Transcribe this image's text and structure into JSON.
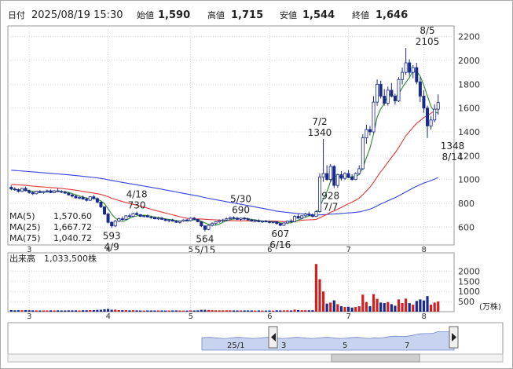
{
  "header": {
    "date_label": "日付",
    "date_value": "2025/08/19 15:30",
    "open_label": "始値",
    "open_value": "1,590",
    "high_label": "高値",
    "high_value": "1,715",
    "low_label": "安値",
    "low_value": "1,544",
    "close_label": "終値",
    "close_value": "1,646",
    "high_color": "#d40000",
    "low_color": "#007a00"
  },
  "legend": {
    "ma5_label": "MA(5)",
    "ma5_value": "1,570.60",
    "ma5_color": "#2a8a2a",
    "ma25_label": "MA(25)",
    "ma25_value": "1,667.72",
    "ma25_color": "#e53333",
    "ma75_label": "MA(75)",
    "ma75_value": "1,040.72",
    "ma75_color": "#3344dd"
  },
  "volume_legend": {
    "label": "出来高",
    "value": "1,033,500株"
  },
  "volume_unit": "(万株)",
  "navigator": {
    "labels": [
      "25/1",
      "3",
      "5",
      "7"
    ]
  },
  "chart_data": {
    "type": "candlestick",
    "months": [
      "3",
      "4",
      "5",
      "6",
      "7",
      "8"
    ],
    "price_ticks": [
      600,
      800,
      1000,
      1200,
      1400,
      1600,
      1800,
      2000,
      2200
    ],
    "price_range": [
      450,
      2290
    ],
    "volume_ticks": [
      500,
      1000,
      1500,
      2000
    ],
    "volume_range": [
      0,
      2400
    ],
    "annotations": [
      {
        "date": "4/9",
        "value": 593,
        "position": "below"
      },
      {
        "date": "4/18",
        "value": 730,
        "position": "above"
      },
      {
        "date": "5/15",
        "value": 564,
        "position": "below"
      },
      {
        "date": "5/30",
        "value": 690,
        "position": "above"
      },
      {
        "date": "6/16",
        "value": 607,
        "position": "below"
      },
      {
        "date": "7/2",
        "value": 1340,
        "position": "above"
      },
      {
        "date": "7/7",
        "value": 928,
        "position": "below"
      },
      {
        "date": "8/5",
        "value": 2105,
        "position": "above"
      },
      {
        "date": "8/14",
        "value": 1348,
        "position": "below"
      }
    ],
    "candles": [
      {
        "o": 935,
        "h": 950,
        "l": 910,
        "c": 920
      },
      {
        "o": 920,
        "h": 935,
        "l": 905,
        "c": 915
      },
      {
        "o": 915,
        "h": 925,
        "l": 890,
        "c": 900
      },
      {
        "o": 900,
        "h": 930,
        "l": 895,
        "c": 925
      },
      {
        "o": 925,
        "h": 940,
        "l": 900,
        "c": 905
      },
      {
        "o": 905,
        "h": 915,
        "l": 880,
        "c": 890
      },
      {
        "o": 890,
        "h": 900,
        "l": 870,
        "c": 880
      },
      {
        "o": 880,
        "h": 905,
        "l": 875,
        "c": 900
      },
      {
        "o": 900,
        "h": 910,
        "l": 885,
        "c": 890
      },
      {
        "o": 890,
        "h": 905,
        "l": 880,
        "c": 900
      },
      {
        "o": 900,
        "h": 915,
        "l": 890,
        "c": 905
      },
      {
        "o": 905,
        "h": 915,
        "l": 885,
        "c": 890
      },
      {
        "o": 890,
        "h": 910,
        "l": 885,
        "c": 905
      },
      {
        "o": 905,
        "h": 925,
        "l": 895,
        "c": 900
      },
      {
        "o": 900,
        "h": 910,
        "l": 885,
        "c": 895
      },
      {
        "o": 895,
        "h": 905,
        "l": 880,
        "c": 885
      },
      {
        "o": 885,
        "h": 895,
        "l": 865,
        "c": 870
      },
      {
        "o": 870,
        "h": 880,
        "l": 850,
        "c": 860
      },
      {
        "o": 860,
        "h": 870,
        "l": 840,
        "c": 845
      },
      {
        "o": 845,
        "h": 860,
        "l": 835,
        "c": 850
      },
      {
        "o": 850,
        "h": 865,
        "l": 830,
        "c": 835
      },
      {
        "o": 835,
        "h": 850,
        "l": 815,
        "c": 825
      },
      {
        "o": 825,
        "h": 860,
        "l": 820,
        "c": 855
      },
      {
        "o": 855,
        "h": 870,
        "l": 830,
        "c": 840
      },
      {
        "o": 840,
        "h": 850,
        "l": 800,
        "c": 810
      },
      {
        "o": 810,
        "h": 815,
        "l": 760,
        "c": 770
      },
      {
        "o": 770,
        "h": 775,
        "l": 700,
        "c": 710
      },
      {
        "o": 710,
        "h": 720,
        "l": 630,
        "c": 640
      },
      {
        "o": 640,
        "h": 650,
        "l": 593,
        "c": 610
      },
      {
        "o": 610,
        "h": 660,
        "l": 600,
        "c": 650
      },
      {
        "o": 650,
        "h": 680,
        "l": 640,
        "c": 670
      },
      {
        "o": 670,
        "h": 690,
        "l": 655,
        "c": 665
      },
      {
        "o": 665,
        "h": 700,
        "l": 660,
        "c": 695
      },
      {
        "o": 695,
        "h": 712,
        "l": 680,
        "c": 690
      },
      {
        "o": 690,
        "h": 720,
        "l": 685,
        "c": 715
      },
      {
        "o": 715,
        "h": 730,
        "l": 700,
        "c": 705
      },
      {
        "o": 705,
        "h": 710,
        "l": 685,
        "c": 690
      },
      {
        "o": 690,
        "h": 700,
        "l": 680,
        "c": 695
      },
      {
        "o": 695,
        "h": 705,
        "l": 680,
        "c": 685
      },
      {
        "o": 685,
        "h": 695,
        "l": 670,
        "c": 680
      },
      {
        "o": 680,
        "h": 690,
        "l": 665,
        "c": 670
      },
      {
        "o": 670,
        "h": 685,
        "l": 660,
        "c": 675
      },
      {
        "o": 675,
        "h": 685,
        "l": 660,
        "c": 665
      },
      {
        "o": 665,
        "h": 672,
        "l": 650,
        "c": 655
      },
      {
        "o": 655,
        "h": 665,
        "l": 640,
        "c": 660
      },
      {
        "o": 660,
        "h": 670,
        "l": 645,
        "c": 650
      },
      {
        "o": 650,
        "h": 660,
        "l": 635,
        "c": 640
      },
      {
        "o": 640,
        "h": 655,
        "l": 630,
        "c": 650
      },
      {
        "o": 650,
        "h": 665,
        "l": 645,
        "c": 660
      },
      {
        "o": 660,
        "h": 670,
        "l": 650,
        "c": 655
      },
      {
        "o": 655,
        "h": 680,
        "l": 650,
        "c": 675
      },
      {
        "o": 675,
        "h": 685,
        "l": 660,
        "c": 665
      },
      {
        "o": 665,
        "h": 670,
        "l": 640,
        "c": 645
      },
      {
        "o": 645,
        "h": 650,
        "l": 600,
        "c": 610
      },
      {
        "o": 610,
        "h": 615,
        "l": 564,
        "c": 580
      },
      {
        "o": 580,
        "h": 620,
        "l": 575,
        "c": 615
      },
      {
        "o": 615,
        "h": 640,
        "l": 605,
        "c": 630
      },
      {
        "o": 630,
        "h": 650,
        "l": 620,
        "c": 645
      },
      {
        "o": 645,
        "h": 665,
        "l": 635,
        "c": 655
      },
      {
        "o": 655,
        "h": 670,
        "l": 640,
        "c": 660
      },
      {
        "o": 660,
        "h": 680,
        "l": 650,
        "c": 670
      },
      {
        "o": 670,
        "h": 690,
        "l": 660,
        "c": 680
      },
      {
        "o": 680,
        "h": 690,
        "l": 665,
        "c": 675
      },
      {
        "o": 675,
        "h": 685,
        "l": 660,
        "c": 665
      },
      {
        "o": 665,
        "h": 680,
        "l": 655,
        "c": 675
      },
      {
        "o": 675,
        "h": 685,
        "l": 660,
        "c": 670
      },
      {
        "o": 670,
        "h": 680,
        "l": 655,
        "c": 660
      },
      {
        "o": 660,
        "h": 670,
        "l": 645,
        "c": 650
      },
      {
        "o": 650,
        "h": 662,
        "l": 640,
        "c": 655
      },
      {
        "o": 655,
        "h": 665,
        "l": 640,
        "c": 645
      },
      {
        "o": 645,
        "h": 655,
        "l": 635,
        "c": 650
      },
      {
        "o": 650,
        "h": 660,
        "l": 640,
        "c": 645
      },
      {
        "o": 645,
        "h": 655,
        "l": 630,
        "c": 640
      },
      {
        "o": 640,
        "h": 650,
        "l": 630,
        "c": 645
      },
      {
        "o": 645,
        "h": 650,
        "l": 620,
        "c": 630
      },
      {
        "o": 630,
        "h": 635,
        "l": 607,
        "c": 615
      },
      {
        "o": 615,
        "h": 640,
        "l": 610,
        "c": 635
      },
      {
        "o": 635,
        "h": 655,
        "l": 625,
        "c": 650
      },
      {
        "o": 650,
        "h": 665,
        "l": 640,
        "c": 645
      },
      {
        "o": 645,
        "h": 700,
        "l": 640,
        "c": 690
      },
      {
        "o": 690,
        "h": 710,
        "l": 670,
        "c": 675
      },
      {
        "o": 675,
        "h": 700,
        "l": 665,
        "c": 695
      },
      {
        "o": 695,
        "h": 720,
        "l": 685,
        "c": 710
      },
      {
        "o": 710,
        "h": 730,
        "l": 695,
        "c": 700
      },
      {
        "o": 700,
        "h": 715,
        "l": 680,
        "c": 690
      },
      {
        "o": 690,
        "h": 740,
        "l": 685,
        "c": 730
      },
      {
        "o": 730,
        "h": 1050,
        "l": 720,
        "c": 1020
      },
      {
        "o": 1020,
        "h": 1340,
        "l": 980,
        "c": 1050
      },
      {
        "o": 1050,
        "h": 1120,
        "l": 990,
        "c": 1000
      },
      {
        "o": 1000,
        "h": 1130,
        "l": 980,
        "c": 1110
      },
      {
        "o": 1110,
        "h": 1120,
        "l": 928,
        "c": 950
      },
      {
        "o": 950,
        "h": 1050,
        "l": 930,
        "c": 1040
      },
      {
        "o": 1040,
        "h": 1070,
        "l": 990,
        "c": 1010
      },
      {
        "o": 1010,
        "h": 1060,
        "l": 995,
        "c": 1050
      },
      {
        "o": 1050,
        "h": 1080,
        "l": 1010,
        "c": 1020
      },
      {
        "o": 1020,
        "h": 1045,
        "l": 990,
        "c": 1000
      },
      {
        "o": 1000,
        "h": 1060,
        "l": 995,
        "c": 1050
      },
      {
        "o": 1050,
        "h": 1120,
        "l": 1040,
        "c": 1090
      },
      {
        "o": 1090,
        "h": 1380,
        "l": 1080,
        "c": 1350
      },
      {
        "o": 1350,
        "h": 1460,
        "l": 1300,
        "c": 1420
      },
      {
        "o": 1420,
        "h": 1450,
        "l": 1370,
        "c": 1400
      },
      {
        "o": 1400,
        "h": 1700,
        "l": 1390,
        "c": 1650
      },
      {
        "o": 1650,
        "h": 1840,
        "l": 1620,
        "c": 1800
      },
      {
        "o": 1800,
        "h": 1830,
        "l": 1680,
        "c": 1700
      },
      {
        "o": 1700,
        "h": 1760,
        "l": 1620,
        "c": 1640
      },
      {
        "o": 1640,
        "h": 1780,
        "l": 1620,
        "c": 1750
      },
      {
        "o": 1750,
        "h": 1810,
        "l": 1690,
        "c": 1700
      },
      {
        "o": 1700,
        "h": 1720,
        "l": 1630,
        "c": 1660
      },
      {
        "o": 1660,
        "h": 1860,
        "l": 1650,
        "c": 1840
      },
      {
        "o": 1840,
        "h": 1940,
        "l": 1800,
        "c": 1900
      },
      {
        "o": 1900,
        "h": 2105,
        "l": 1880,
        "c": 1980
      },
      {
        "o": 1980,
        "h": 2010,
        "l": 1870,
        "c": 1900
      },
      {
        "o": 1900,
        "h": 1960,
        "l": 1850,
        "c": 1940
      },
      {
        "o": 1940,
        "h": 1980,
        "l": 1800,
        "c": 1820
      },
      {
        "o": 1820,
        "h": 1860,
        "l": 1650,
        "c": 1700
      },
      {
        "o": 1700,
        "h": 1750,
        "l": 1560,
        "c": 1600
      },
      {
        "o": 1600,
        "h": 1620,
        "l": 1348,
        "c": 1450
      },
      {
        "o": 1450,
        "h": 1530,
        "l": 1420,
        "c": 1500
      },
      {
        "o": 1500,
        "h": 1630,
        "l": 1480,
        "c": 1590
      },
      {
        "o": 1590,
        "h": 1715,
        "l": 1544,
        "c": 1646
      }
    ]
  }
}
